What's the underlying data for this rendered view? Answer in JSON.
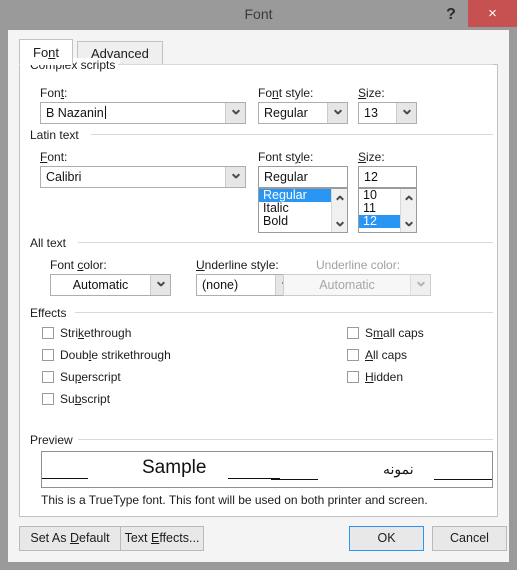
{
  "window": {
    "title": "Font",
    "help_label": "?",
    "close_label": "×"
  },
  "tabs": [
    {
      "label": "Font",
      "accel_before": "Fo",
      "accel": "n",
      "accel_after": "t",
      "active": true
    },
    {
      "label": "Advanced",
      "accel_before": "Ad",
      "accel": "v",
      "accel_after": "anced",
      "active": false
    }
  ],
  "complex_scripts": {
    "group_label": "Complex scripts",
    "font": {
      "label_before": "Fon",
      "label_accel": "t",
      "label_after": ":",
      "value": "B Nazanin"
    },
    "font_style": {
      "label_before": "Fo",
      "label_accel": "n",
      "label_after": "t style:",
      "value": "Regular"
    },
    "size": {
      "label_accel": "S",
      "label_after": "ize:",
      "value": "13"
    }
  },
  "latin_text": {
    "group_label": "Latin text",
    "font": {
      "label_accel": "F",
      "label_after": "ont:",
      "value": "Calibri"
    },
    "font_style": {
      "label_before": "Font st",
      "label_accel": "y",
      "label_after": "le:",
      "value": "Regular",
      "options": [
        "Regular",
        "Italic",
        "Bold"
      ],
      "selected": "Regular"
    },
    "size": {
      "label_accel": "S",
      "label_after": "ize:",
      "value": "12",
      "options": [
        "10",
        "11",
        "12"
      ],
      "selected": "12"
    }
  },
  "all_text": {
    "group_label": "All text",
    "font_color": {
      "label_before": "Font ",
      "label_accel": "c",
      "label_after": "olor:",
      "value": "Automatic"
    },
    "underline_style": {
      "label_accel": "U",
      "label_after": "nderline style:",
      "value": "(none)"
    },
    "underline_color": {
      "label": "Underline color:",
      "value": "Automatic",
      "disabled": true
    }
  },
  "effects": {
    "group_label": "Effects",
    "left_column": [
      {
        "label_before": "Stri",
        "accel": "k",
        "label_after": "ethrough",
        "checked": false
      },
      {
        "label_before": "Doub",
        "accel": "l",
        "label_after": "e strikethrough",
        "checked": false
      },
      {
        "label_before": "Su",
        "accel": "p",
        "label_after": "erscript",
        "checked": false
      },
      {
        "label_before": "Su",
        "accel": "b",
        "label_after": "script",
        "checked": false
      }
    ],
    "right_column": [
      {
        "label_before": "S",
        "accel": "m",
        "label_after": "all caps",
        "checked": false
      },
      {
        "label_before": "",
        "accel": "A",
        "label_after": "ll caps",
        "checked": false
      },
      {
        "label_before": "",
        "accel": "H",
        "label_after": "idden",
        "checked": false
      }
    ]
  },
  "preview": {
    "group_label": "Preview",
    "sample_latin": "Sample",
    "sample_arabic": "نمونه",
    "note": "This is a TrueType font. This font will be used on both printer and screen."
  },
  "footer": {
    "set_as_default": {
      "label_before": "Set As ",
      "accel": "D",
      "label_after": "efault"
    },
    "text_effects": {
      "label_before": "Text ",
      "accel": "E",
      "label_after": "ffects..."
    },
    "ok": "OK",
    "cancel": "Cancel"
  },
  "colors": {
    "frame": "#9a9a9a",
    "panel": "#f4f4f4",
    "accent_selection": "#2a96f3",
    "close_button": "#c75050"
  }
}
